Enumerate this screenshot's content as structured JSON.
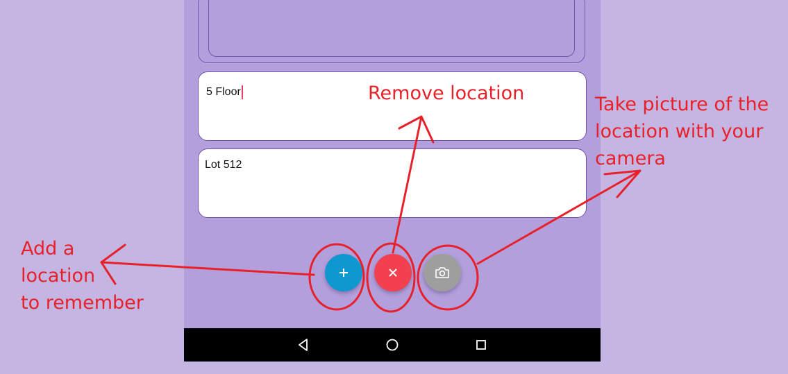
{
  "form": {
    "floor_value": "5 Floor",
    "lot_value": "Lot 512"
  },
  "actions": {
    "add": {
      "icon": "plus-icon",
      "color": "#0f97cf"
    },
    "remove": {
      "icon": "close-icon",
      "color": "#f2404f"
    },
    "camera": {
      "icon": "camera-icon",
      "color": "#9e9e9e"
    }
  },
  "navigation": {
    "back": "back-triangle-icon",
    "home": "home-circle-icon",
    "recents": "recents-square-icon"
  },
  "annotations": {
    "add_lines": [
      "Add a",
      "location",
      "to remember"
    ],
    "remove_lines": [
      "Remove location"
    ],
    "camera_lines": [
      "Take picture of the",
      "location with your",
      "camera"
    ],
    "ink_color": "#e8202a"
  },
  "theme": {
    "background": "#c4b5e3",
    "screen": "#b29fdc",
    "border": "#6f55a8"
  }
}
